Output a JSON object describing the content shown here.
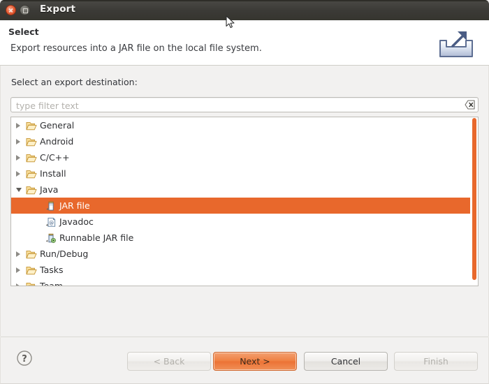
{
  "window": {
    "title": "Export",
    "close_icon": "close-icon",
    "maximize_icon": "maximize-icon"
  },
  "header": {
    "title": "Select",
    "description": "Export resources into a JAR file on the local file system.",
    "icon": "export-banner-icon"
  },
  "body": {
    "destination_label": "Select an export destination:",
    "filter": {
      "value": "",
      "placeholder": "type filter text",
      "clear_icon": "clear-filter-icon"
    }
  },
  "tree": {
    "items": [
      {
        "label": "General",
        "icon": "folder-icon",
        "indent": 0,
        "state": "collapsed",
        "selected": false
      },
      {
        "label": "Android",
        "icon": "folder-icon",
        "indent": 0,
        "state": "collapsed",
        "selected": false
      },
      {
        "label": "C/C++",
        "icon": "folder-icon",
        "indent": 0,
        "state": "collapsed",
        "selected": false
      },
      {
        "label": "Install",
        "icon": "folder-icon",
        "indent": 0,
        "state": "collapsed",
        "selected": false
      },
      {
        "label": "Java",
        "icon": "folder-icon",
        "indent": 0,
        "state": "expanded",
        "selected": false
      },
      {
        "label": "JAR file",
        "icon": "jar-file-icon",
        "indent": 1,
        "state": "leaf",
        "selected": true
      },
      {
        "label": "Javadoc",
        "icon": "javadoc-icon",
        "indent": 1,
        "state": "leaf",
        "selected": false
      },
      {
        "label": "Runnable JAR file",
        "icon": "runnable-jar-icon",
        "indent": 1,
        "state": "leaf",
        "selected": false
      },
      {
        "label": "Run/Debug",
        "icon": "folder-icon",
        "indent": 0,
        "state": "collapsed",
        "selected": false
      },
      {
        "label": "Tasks",
        "icon": "folder-icon",
        "indent": 0,
        "state": "collapsed",
        "selected": false
      },
      {
        "label": "Team",
        "icon": "folder-icon",
        "indent": 0,
        "state": "collapsed",
        "selected": false
      }
    ],
    "scrollbar_color": "#e8682c"
  },
  "footer": {
    "help_icon": "help-icon",
    "buttons": [
      {
        "label": "< Back",
        "style": "disabled"
      },
      {
        "label": "Next >",
        "style": "default"
      },
      {
        "label": "Cancel",
        "style": "normal"
      },
      {
        "label": "Finish",
        "style": "disabled"
      }
    ]
  },
  "colors": {
    "accent": "#e8682c",
    "titlebar": "#3b3a36",
    "dialog_bg": "#f2f1f0"
  }
}
